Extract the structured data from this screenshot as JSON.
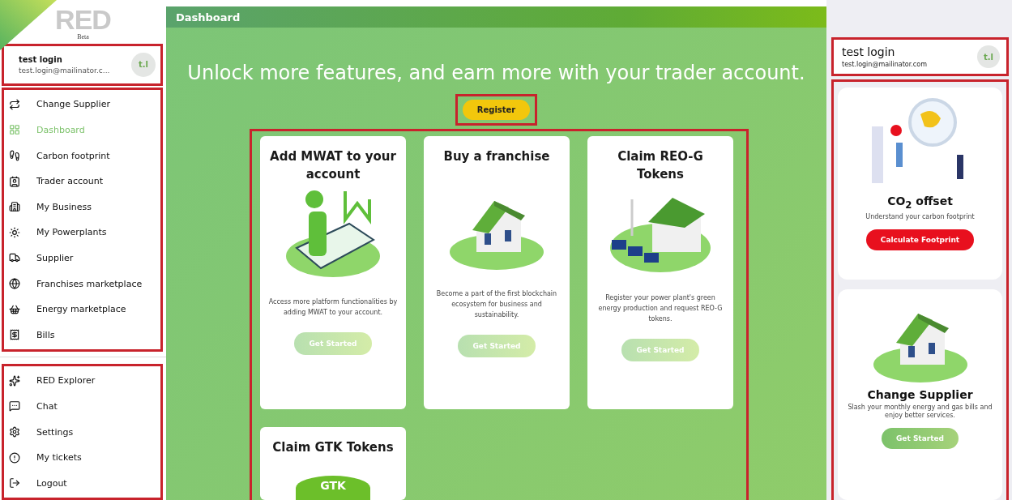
{
  "logo": {
    "text": "RED",
    "badge": "Beta"
  },
  "user": {
    "name": "test login",
    "email": "test.login@mailinator.c...",
    "initials": "t.l"
  },
  "nav_main": [
    {
      "label": "Change Supplier",
      "selected": false
    },
    {
      "label": "Dashboard",
      "selected": true
    },
    {
      "label": "Carbon footprint",
      "selected": false
    },
    {
      "label": "Trader account",
      "selected": false
    },
    {
      "label": "My Business",
      "selected": false
    },
    {
      "label": "My Powerplants",
      "selected": false
    },
    {
      "label": "Supplier",
      "selected": false
    },
    {
      "label": "Franchises marketplace",
      "selected": false
    },
    {
      "label": "Energy marketplace",
      "selected": false
    },
    {
      "label": "Bills",
      "selected": false
    }
  ],
  "nav_secondary": [
    {
      "label": "RED Explorer",
      "selected": false
    },
    {
      "label": "Chat",
      "selected": false
    },
    {
      "label": "Settings",
      "selected": false
    },
    {
      "label": "My tickets",
      "selected": false
    },
    {
      "label": "Logout",
      "selected": false
    }
  ],
  "header": {
    "title": "Dashboard"
  },
  "promo": {
    "headline": "Unlock more features, and earn more with your trader account.",
    "button": "Register"
  },
  "cards": [
    {
      "title": "Add MWAT to your account",
      "text": "Access more platform functionalities by adding MWAT to your account.",
      "button": "Get Started"
    },
    {
      "title": "Buy a franchise",
      "text": "Become a part of the first blockchain ecosystem for business and sustainability.",
      "button": "Get Started"
    },
    {
      "title": "Claim REO-G Tokens",
      "text": "Register your power plant's green energy production and request REO-G tokens.",
      "button": "Get Started"
    },
    {
      "title": "Claim GTK Tokens",
      "badge": "GTK"
    }
  ],
  "right_user": {
    "name": "test login",
    "email": "test.login@mailinator.com",
    "initials": "t.l"
  },
  "side_cards": [
    {
      "kind": "co2",
      "title": "CO$_{2}$ offset",
      "text": "Understand your carbon footprint",
      "button": "Calculate Footprint"
    },
    {
      "kind": "supplier",
      "title": "Change Supplier",
      "text": "Slash your monthly energy and gas bills and enjoy better services.",
      "button": "Get Started"
    }
  ]
}
